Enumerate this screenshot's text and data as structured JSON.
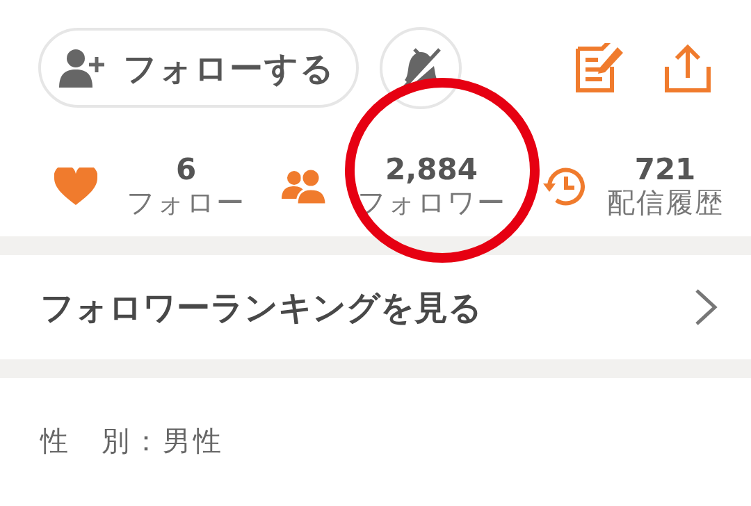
{
  "follow_button": {
    "label": "フォローする"
  },
  "stats": [
    {
      "kind": "heart",
      "value": "6",
      "label": "フォロー"
    },
    {
      "kind": "people",
      "value": "2,884",
      "label": "フォロワー"
    },
    {
      "kind": "history",
      "value": "721",
      "label": "配信履歴"
    }
  ],
  "ranking_link": {
    "label": "フォロワーランキングを見る"
  },
  "profile_fields": [
    "性　別：男性"
  ],
  "annotation": {
    "kind": "circle",
    "color": "#e60012"
  }
}
